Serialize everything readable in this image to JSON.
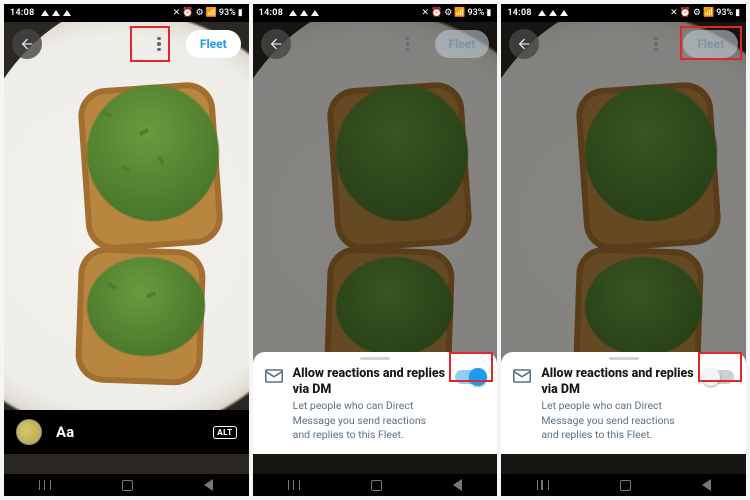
{
  "status": {
    "time": "14:08",
    "battery": "93%"
  },
  "header": {
    "fleet_label": "Fleet"
  },
  "compose": {
    "text_label": "Aa",
    "alt_label": "ALT"
  },
  "sheet": {
    "title": "Allow reactions and replies via DM",
    "desc": "Let people who can Direct Message you send reactions and replies to this Fleet."
  }
}
